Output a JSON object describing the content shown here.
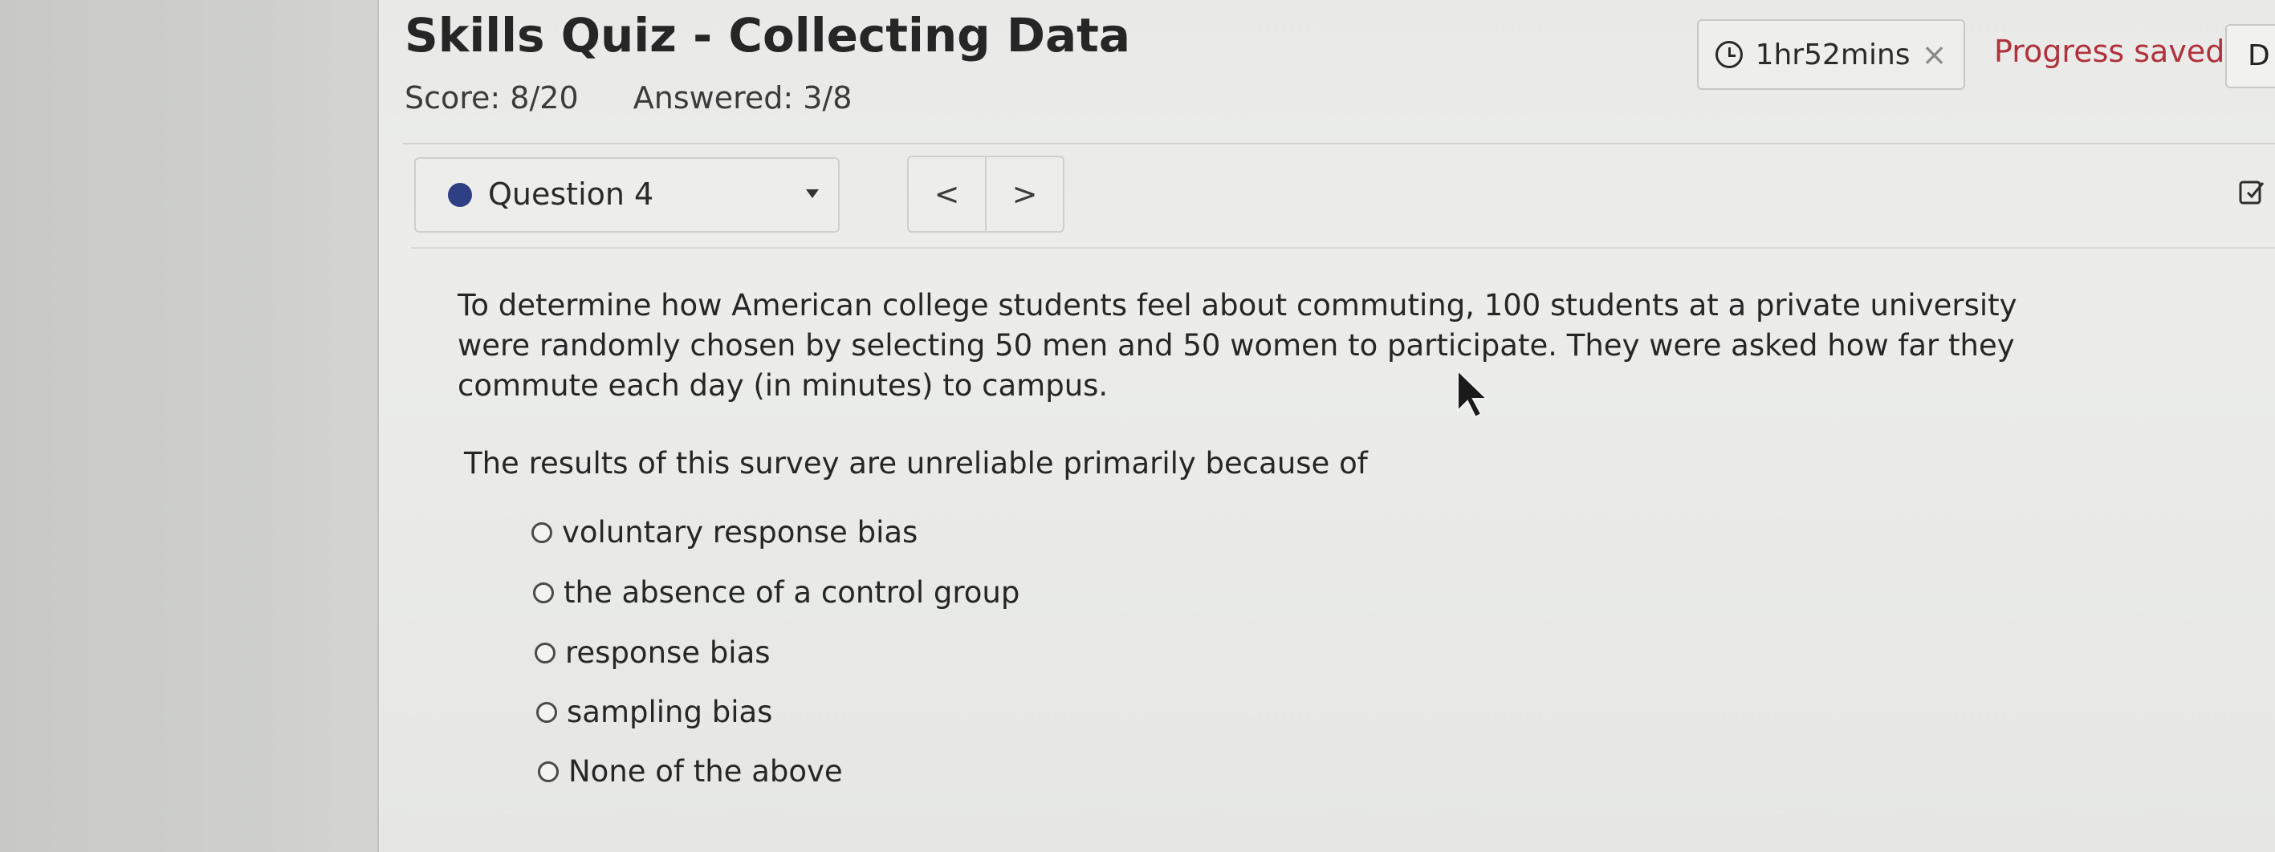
{
  "header": {
    "title": "Skills Quiz - Collecting Data",
    "score": "Score: 8/20",
    "answered": "Answered: 3/8",
    "timer": "1hr52mins",
    "timer_close": "×",
    "progress_status": "Progress saved",
    "done_button": "D"
  },
  "nav": {
    "question_label": "Question 4",
    "prev_symbol": "<",
    "next_symbol": ">"
  },
  "question": {
    "prompt": "To determine how American college students feel about commuting, 100 students at a private university were randomly chosen by selecting 50 men and 50 women to participate. They were asked how far they commute each day (in minutes) to campus.",
    "ask": "The results of this survey are unreliable primarily because of",
    "options": [
      "voluntary response bias",
      "the absence of a control group",
      "response bias",
      "sampling bias",
      "None of the above"
    ]
  },
  "colors": {
    "progress_saved": "#b0323c",
    "question_dot": "#2f3f84"
  },
  "icons": [
    "clock-icon",
    "close-icon",
    "chevron-down-icon",
    "edit-icon",
    "mouse-cursor-icon"
  ]
}
